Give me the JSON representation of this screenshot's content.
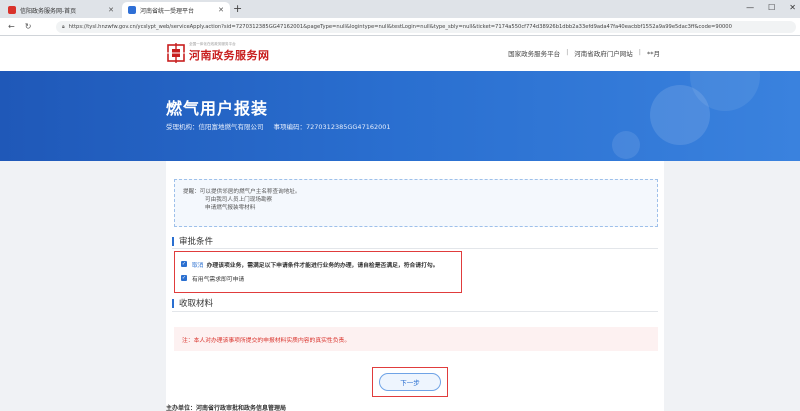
{
  "browser": {
    "tabs": [
      {
        "title": "信阳政务服务网-首页",
        "active": false
      },
      {
        "title": "河南省统一受理平台",
        "active": true
      }
    ],
    "new_tab": "+",
    "url": "https://tysl.hnzwfw.gov.cn/ycslypt_web/serviceApply.action?sid=7270312385GG47162001&pageType=null&logintype=null&testLogin=null&type_sbly=null&ticket=7174a550cf774d38926b1dbb2a33efd9ada47fa40eacbbf1552a9a99e5dac3ff&code=90000"
  },
  "site": {
    "logo_subtitle": "全国一体化在线政务服务平台",
    "logo_title": "河南政务服务网",
    "links": [
      "国家政务服务平台",
      "河南省政府门户网站",
      "**月"
    ]
  },
  "banner": {
    "title": "燃气用户报装",
    "agency": "受理机构：信阳富地燃气有限公司",
    "item_code": "事项编码：7270312385GG47162001"
  },
  "tip": {
    "line1": "提醒：可以提供邻居的燃气户主名称查询地址。",
    "line2": "可由我司人员上门现场勘察",
    "line3": "申请燃气报装零材料"
  },
  "conditions": {
    "heading": "审批条件",
    "cancel_label": "取消",
    "row1": "办理该项业务，需满足以下申请条件才能进行业务的办理，请自检是否满足，符合请打勾。",
    "row2": "有用气需求即可申请"
  },
  "materials": {
    "heading": "收取材料",
    "notice": "注：本人对办理该事项所提交的申报材料实质内容的真实性负责。"
  },
  "actions": {
    "next_label": "下一步"
  },
  "footer": {
    "text": "主办单位：河南省行政审批和政务信息管理局"
  },
  "colors": {
    "banner": "#2a6fd0",
    "accent": "#2a6fd0",
    "brand_red": "#c81e1e",
    "highlight_red": "#e03c3c"
  }
}
